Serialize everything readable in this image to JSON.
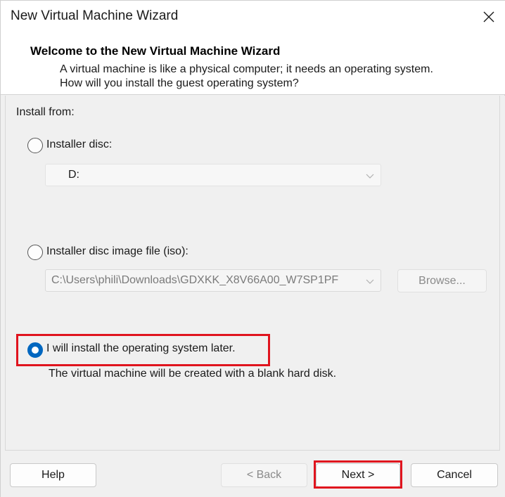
{
  "window": {
    "title": "New Virtual Machine Wizard"
  },
  "header": {
    "title": "Welcome to the New Virtual Machine Wizard",
    "description": "A virtual machine is like a physical computer; it needs an operating system. How will you install the guest operating system?"
  },
  "install_from": {
    "label": "Install from:",
    "options": [
      {
        "label": "Installer disc:",
        "checked": false,
        "value": "D:"
      },
      {
        "label": "Installer disc image file (iso):",
        "checked": false,
        "value": "C:\\Users\\phili\\Downloads\\GDXKK_X8V66A00_W7SP1PF",
        "browse_label": "Browse..."
      },
      {
        "label": "I will install the operating system later.",
        "checked": true,
        "note": "The virtual machine will be created with a blank hard disk."
      }
    ]
  },
  "footer": {
    "help": "Help",
    "back": "< Back",
    "next": "Next >",
    "cancel": "Cancel"
  },
  "colors": {
    "accent": "#0067c0",
    "highlight": "#e0141e"
  },
  "icons": [
    "close-icon",
    "chevron-down-icon"
  ]
}
